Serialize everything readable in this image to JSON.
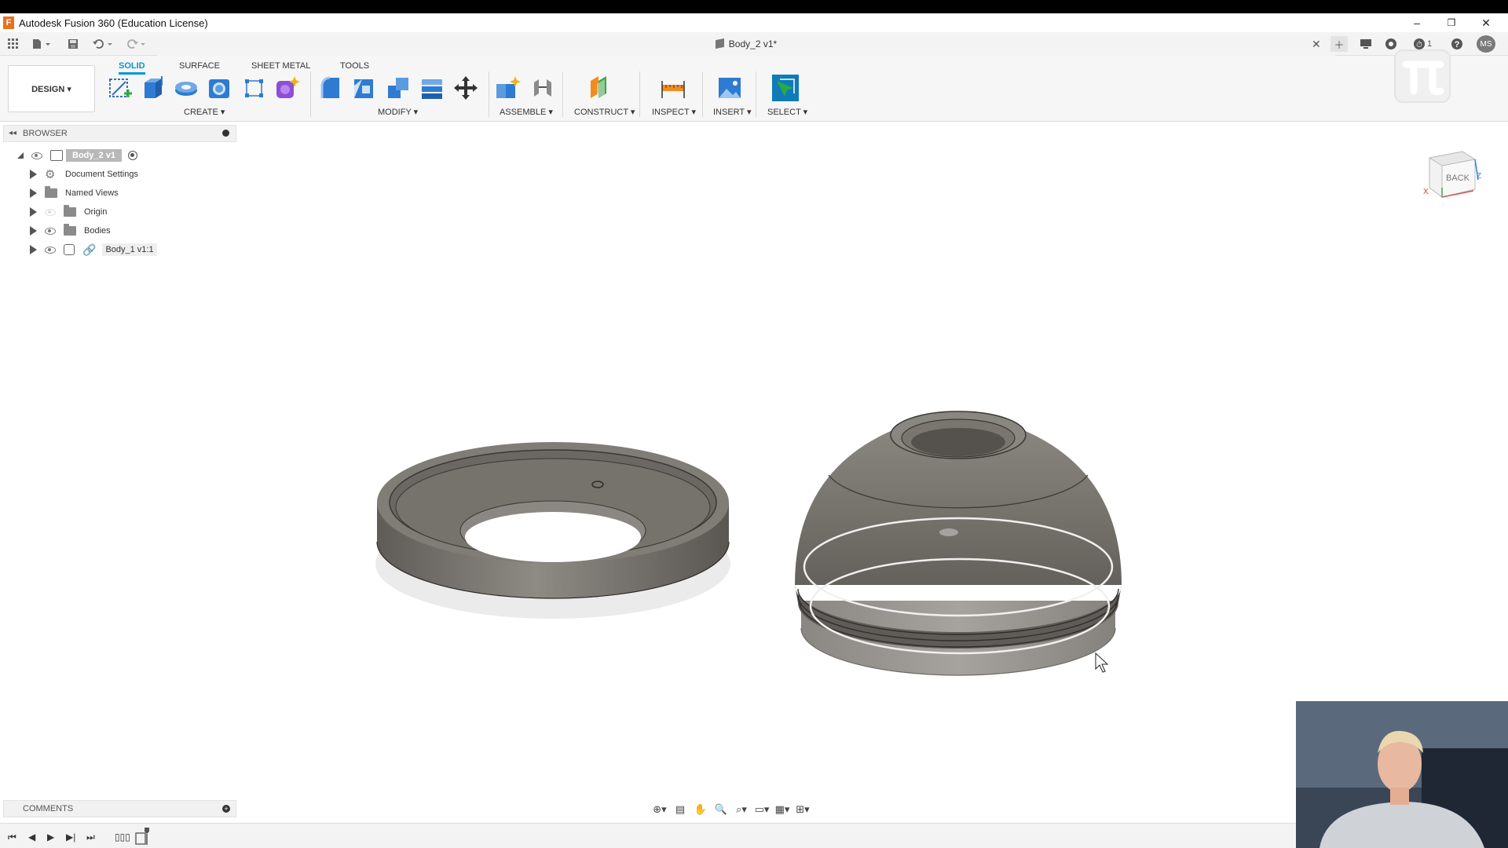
{
  "window": {
    "title": "Autodesk Fusion 360 (Education License)",
    "logo_letter": "F",
    "minimize": "–",
    "restore": "❐",
    "close": "✕"
  },
  "document": {
    "tab_title": "Body_2 v1*",
    "close": "✕",
    "notifications_count": "1",
    "user_initials": "MS"
  },
  "ribbon": {
    "workspace": "DESIGN ▾",
    "tabs": [
      "SOLID",
      "SURFACE",
      "SHEET METAL",
      "TOOLS"
    ],
    "active_tab": "SOLID",
    "groups": {
      "create": "CREATE ▾",
      "modify": "MODIFY ▾",
      "assemble": "ASSEMBLE ▾",
      "construct": "CONSTRUCT ▾",
      "inspect": "INSPECT ▾",
      "insert": "INSERT ▾",
      "select": "SELECT ▾"
    }
  },
  "browser": {
    "title": "BROWSER",
    "root": "Body_2 v1",
    "items": [
      {
        "label": "Document Settings",
        "icon": "gear-icon"
      },
      {
        "label": "Named Views",
        "icon": "folder-icon"
      },
      {
        "label": "Origin",
        "icon": "folder-icon"
      },
      {
        "label": "Bodies",
        "icon": "folder-icon"
      },
      {
        "label": "Body_1 v1:1",
        "icon": "link-icon"
      }
    ]
  },
  "viewcube": {
    "face": "BACK",
    "axis_x": "X",
    "axis_z": "Z"
  },
  "comments": {
    "title": "COMMENTS"
  },
  "colors": {
    "accent": "#0696d7",
    "model_gray": "#7a7670"
  }
}
